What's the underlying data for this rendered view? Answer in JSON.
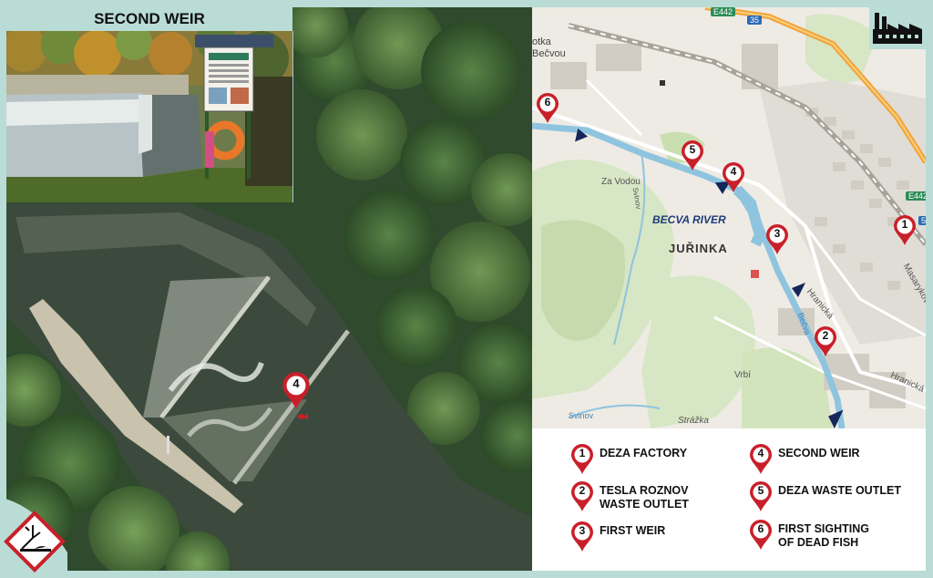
{
  "inset": {
    "title": "SECOND WEIR"
  },
  "map": {
    "labels": {
      "river": "BECVA RIVER",
      "jurinka": "JUŘINKA",
      "za_vodou": "Za Vodou",
      "vrbi": "Vrbí",
      "strazka": "Strážka",
      "svinov_creek": "Svinov",
      "svinov": "Svinov",
      "hranicka_1": "Hranická",
      "hranicka_2": "Hranická",
      "masarykovo": "Masarykovo",
      "becva_small": "Bečva",
      "town_top": "otka\nBečvou"
    },
    "road_badges": {
      "e442_top": "E442",
      "r35": "35",
      "e442_right": "E442",
      "r5_right": "5"
    }
  },
  "markers": {
    "m1": "1",
    "m2": "2",
    "m3": "3",
    "m4": "4",
    "m5": "5",
    "m6": "6",
    "aerial_m4": "4"
  },
  "legend": [
    {
      "num": "1",
      "text": "DEZA FACTORY"
    },
    {
      "num": "2",
      "text": "TESLA ROZNOV\nWASTE OUTLET"
    },
    {
      "num": "3",
      "text": "FIRST WEIR"
    },
    {
      "num": "4",
      "text": "SECOND WEIR"
    },
    {
      "num": "5",
      "text": "DEZA WASTE OUTLET"
    },
    {
      "num": "6",
      "text": "FIRST SIGHTING\nOF DEAD FISH"
    }
  ],
  "icons": {
    "factory": "factory-icon",
    "hazard": "environmental-hazard-icon",
    "pin": "map-pin-icon"
  },
  "colors": {
    "frame": "#b9dcd6",
    "pin": "#c8202a",
    "river": "#8fc4df",
    "arrow": "#15265a"
  }
}
